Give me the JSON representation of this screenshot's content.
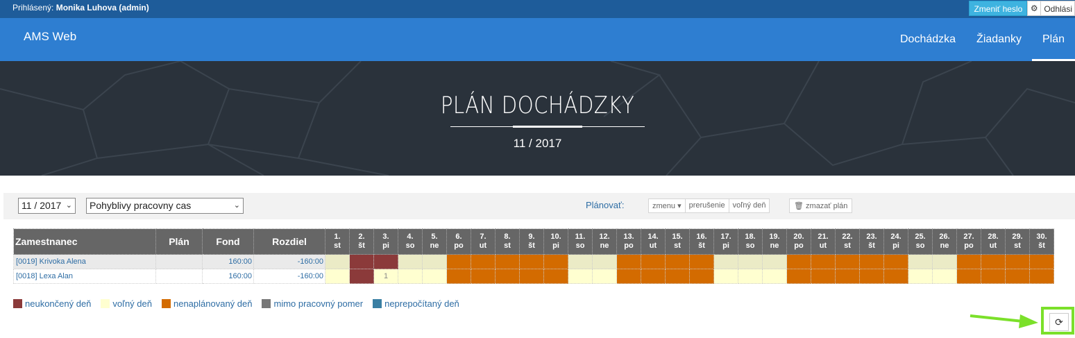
{
  "topbar": {
    "logged_prefix": "Prihlásený:",
    "user": "Monika Luhova (admin)",
    "change_password": "Zmeniť heslo",
    "logout": "Odhlási"
  },
  "nav": {
    "brand": "AMS Web",
    "items": [
      "Dochádzka",
      "Žiadanky",
      "Plán"
    ],
    "active": "Plán"
  },
  "hero": {
    "title": "PLÁN DOCHÁDZKY",
    "subtitle": "11 / 2017"
  },
  "toolbar": {
    "month_select": "11 / 2017",
    "schedule_select": "Pohyblivy pracovny cas",
    "plan_label": "Plánovať:",
    "group_buttons": [
      "zmenu",
      "prerušenie",
      "voľný deň"
    ],
    "delete_plan": "zmazať plán"
  },
  "table": {
    "headers": [
      "Zamestnanec",
      "Plán",
      "Fond",
      "Rozdiel"
    ],
    "days": [
      {
        "d": "1.",
        "w": "st"
      },
      {
        "d": "2.",
        "w": "št"
      },
      {
        "d": "3.",
        "w": "pi"
      },
      {
        "d": "4.",
        "w": "so"
      },
      {
        "d": "5.",
        "w": "ne"
      },
      {
        "d": "6.",
        "w": "po"
      },
      {
        "d": "7.",
        "w": "ut"
      },
      {
        "d": "8.",
        "w": "st"
      },
      {
        "d": "9.",
        "w": "št"
      },
      {
        "d": "10.",
        "w": "pi"
      },
      {
        "d": "11.",
        "w": "so"
      },
      {
        "d": "12.",
        "w": "ne"
      },
      {
        "d": "13.",
        "w": "po"
      },
      {
        "d": "14.",
        "w": "ut"
      },
      {
        "d": "15.",
        "w": "st"
      },
      {
        "d": "16.",
        "w": "št"
      },
      {
        "d": "17.",
        "w": "pi"
      },
      {
        "d": "18.",
        "w": "so"
      },
      {
        "d": "19.",
        "w": "ne"
      },
      {
        "d": "20.",
        "w": "po"
      },
      {
        "d": "21.",
        "w": "ut"
      },
      {
        "d": "22.",
        "w": "st"
      },
      {
        "d": "23.",
        "w": "št"
      },
      {
        "d": "24.",
        "w": "pi"
      },
      {
        "d": "25.",
        "w": "so"
      },
      {
        "d": "26.",
        "w": "ne"
      },
      {
        "d": "27.",
        "w": "po"
      },
      {
        "d": "28.",
        "w": "ut"
      },
      {
        "d": "29.",
        "w": "st"
      },
      {
        "d": "30.",
        "w": "št"
      }
    ],
    "rows": [
      {
        "name": "[0019] Krivoka Alena",
        "plan": "",
        "fond": "160:00",
        "rozdiel": "-160:00",
        "cells": [
          "free",
          "unf",
          "unf",
          "free",
          "free",
          "unp",
          "unp",
          "unp",
          "unp",
          "unp",
          "free",
          "free",
          "unp",
          "unp",
          "unp",
          "unp",
          "free",
          "free",
          "free",
          "unp",
          "unp",
          "unp",
          "unp",
          "unp",
          "free",
          "free",
          "unp",
          "unp",
          "unp",
          "unp"
        ],
        "cell_text": [
          "",
          "",
          "",
          "",
          "",
          "",
          "",
          "",
          "",
          "",
          "",
          "",
          "",
          "",
          "",
          "",
          "",
          "",
          "",
          "",
          "",
          "",
          "",
          "",
          "",
          "",
          "",
          "",
          "",
          ""
        ]
      },
      {
        "name": "[0018] Lexa Alan",
        "plan": "",
        "fond": "160:00",
        "rozdiel": "-160:00",
        "cells": [
          "free",
          "unf",
          "free",
          "free",
          "free",
          "unp",
          "unp",
          "unp",
          "unp",
          "unp",
          "free",
          "free",
          "unp",
          "unp",
          "unp",
          "unp",
          "free",
          "free",
          "free",
          "unp",
          "unp",
          "unp",
          "unp",
          "unp",
          "free",
          "free",
          "unp",
          "unp",
          "unp",
          "unp"
        ],
        "cell_text": [
          "",
          "",
          "1",
          "",
          "",
          "",
          "",
          "",
          "",
          "",
          "",
          "",
          "",
          "",
          "",
          "",
          "",
          "",
          "",
          "",
          "",
          "",
          "",
          "",
          "",
          "",
          "",
          "",
          "",
          ""
        ]
      }
    ]
  },
  "legend": [
    {
      "label": "neukončený deň",
      "color": "#8b3a3a"
    },
    {
      "label": "voľný deň",
      "color": "#ffffd0"
    },
    {
      "label": "nenaplánovaný deň",
      "color": "#d36b00"
    },
    {
      "label": "mimo pracovný pomer",
      "color": "#777777"
    },
    {
      "label": "neprepočítaný deň",
      "color": "#3a7fa3"
    }
  ],
  "colors": {
    "topbar": "#1e5c9a",
    "navbar": "#2e7ed1",
    "hero": "#2a323b",
    "highlight": "#7be02a"
  }
}
